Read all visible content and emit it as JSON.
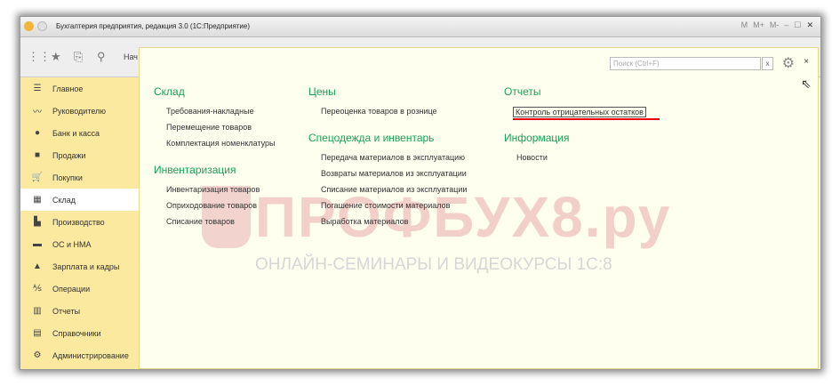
{
  "window": {
    "title": "Бухгалтерия предприятия, редакция 3.0  (1С:Предприятие)",
    "title_icons": [
      "M",
      "M+",
      "M-"
    ]
  },
  "toolbar": {
    "start_label": "Нач"
  },
  "sidebar": {
    "items": [
      {
        "label": "Главное",
        "icon": "menu-icon",
        "glyph": "☰"
      },
      {
        "label": "Руководителю",
        "icon": "trend-icon",
        "glyph": "〰"
      },
      {
        "label": "Банк и касса",
        "icon": "coin-icon",
        "glyph": "●"
      },
      {
        "label": "Продажи",
        "icon": "bag-icon",
        "glyph": "■"
      },
      {
        "label": "Покупки",
        "icon": "cart-icon",
        "glyph": "🛒"
      },
      {
        "label": "Склад",
        "icon": "warehouse-icon",
        "glyph": "▦",
        "active": true
      },
      {
        "label": "Производство",
        "icon": "factory-icon",
        "glyph": "▙"
      },
      {
        "label": "ОС и НМА",
        "icon": "truck-icon",
        "glyph": "▬"
      },
      {
        "label": "Зарплата и кадры",
        "icon": "person-icon",
        "glyph": "▲"
      },
      {
        "label": "Операции",
        "icon": "operations-icon",
        "glyph": "⅍"
      },
      {
        "label": "Отчеты",
        "icon": "bar-chart-icon",
        "glyph": "▥"
      },
      {
        "label": "Справочники",
        "icon": "books-icon",
        "glyph": "▤"
      },
      {
        "label": "Администрирование",
        "icon": "gear-icon",
        "glyph": "⚙"
      }
    ]
  },
  "panel": {
    "search_placeholder": "Поиск (Ctrl+F)",
    "search_clear": "x",
    "close": "×",
    "columns": [
      {
        "sections": [
          {
            "title": "Склад",
            "links": [
              "Требования-накладные",
              "Перемещение товаров",
              "Комплектация номенклатуры"
            ]
          },
          {
            "title": "Инвентаризация",
            "links": [
              "Инвентаризация товаров",
              "Оприходование товаров",
              "Списание товаров"
            ]
          }
        ]
      },
      {
        "sections": [
          {
            "title": "Цены",
            "links": [
              "Переоценка товаров в рознице"
            ]
          },
          {
            "title": "Спецодежда и инвентарь",
            "links": [
              "Передача материалов в эксплуатацию",
              "Возвраты материалов из эксплуатации",
              "Списание материалов из эксплуатации",
              "Погашение стоимости материалов",
              "Выработка материалов"
            ]
          }
        ]
      },
      {
        "sections": [
          {
            "title": "Отчеты",
            "links": [
              "Контроль отрицательных остатков"
            ]
          },
          {
            "title": "Информация",
            "links": [
              "Новости"
            ]
          }
        ]
      }
    ]
  },
  "watermark": {
    "brand": "ПРОФБУХ8.ру",
    "tagline": "ОНЛАЙН-СЕМИНАРЫ И ВИДЕОКУРСЫ 1С:8"
  }
}
